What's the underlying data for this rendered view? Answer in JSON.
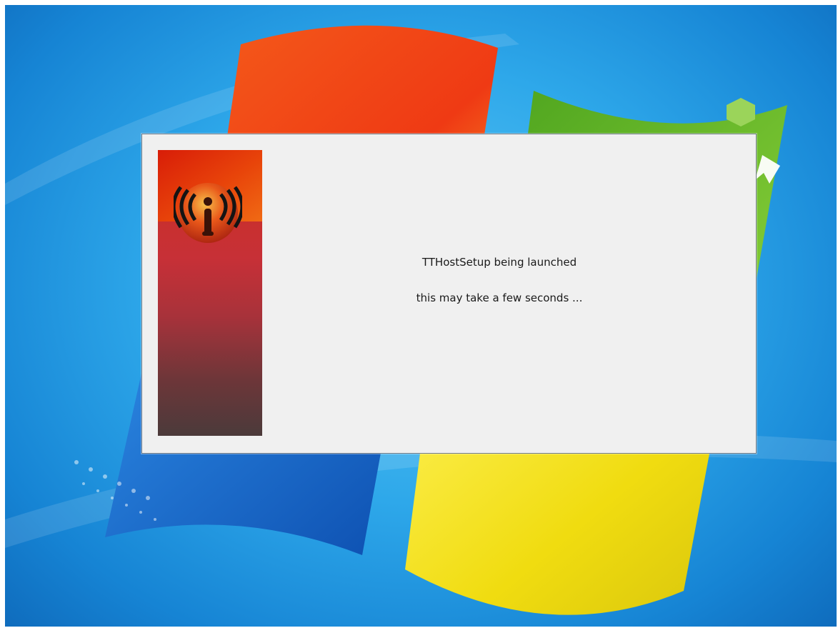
{
  "dialog": {
    "title_line": "TTHostSetup being launched",
    "subtitle_line": "this may take a few seconds ..."
  },
  "banner": {
    "logo_icon": "broadcast-signal-icon",
    "colors": {
      "top": "#e8440a",
      "middle": "#c73037",
      "bottom": "#4b3a3a"
    }
  },
  "desktop": {
    "wallpaper": "windows-7-default",
    "colors": {
      "sky": "#2ea8ea",
      "red_flag": "#f04a1a",
      "green_flag": "#6bb52a",
      "blue_flag": "#1d66c8",
      "yellow_flag": "#f2e11a"
    }
  }
}
